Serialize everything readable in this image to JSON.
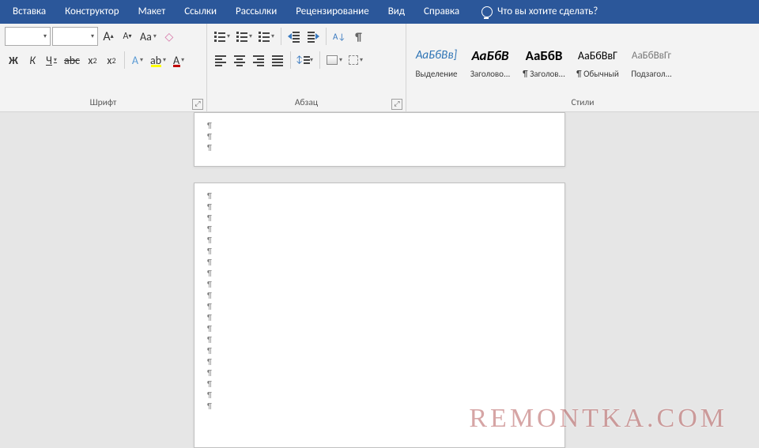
{
  "menu": {
    "tabs": [
      "Вставка",
      "Конструктор",
      "Макет",
      "Ссылки",
      "Рассылки",
      "Рецензирование",
      "Вид",
      "Справка"
    ],
    "tell_me": "Что вы хотите сделать?"
  },
  "groups": {
    "font": {
      "label": "Шрифт"
    },
    "paragraph": {
      "label": "Абзац"
    },
    "styles": {
      "label": "Стили"
    }
  },
  "font_row1": {
    "grow": "A",
    "shrink": "A",
    "case": "Aa"
  },
  "font_row2": {
    "bold": "Ж",
    "italic": "К",
    "underline": "Ч",
    "strike": "abc",
    "sub_base": "x",
    "sub_s": "2",
    "sup_base": "x",
    "sup_s": "2",
    "effects": "A",
    "highlight": "ab",
    "color": "A"
  },
  "styles": [
    {
      "preview": "АаБбВв]",
      "name": "Выделение",
      "css": "color:#2e74b5;font-style:italic;"
    },
    {
      "preview": "АаБбВ",
      "name": "Заголово...",
      "css": "font-weight:bold;font-style:italic;font-size:17px;"
    },
    {
      "preview": "АаБбВ",
      "name": "¶ Заголов...",
      "css": "font-weight:bold;font-size:17px;"
    },
    {
      "preview": "АаБбВвГ",
      "name": "¶ Обычный",
      "css": "font-size:14px;"
    },
    {
      "preview": "АаБбВвГг",
      "name": "Подзагол...",
      "css": "color:#777;font-size:13px;"
    }
  ],
  "watermark": "REMONTKA.COM"
}
